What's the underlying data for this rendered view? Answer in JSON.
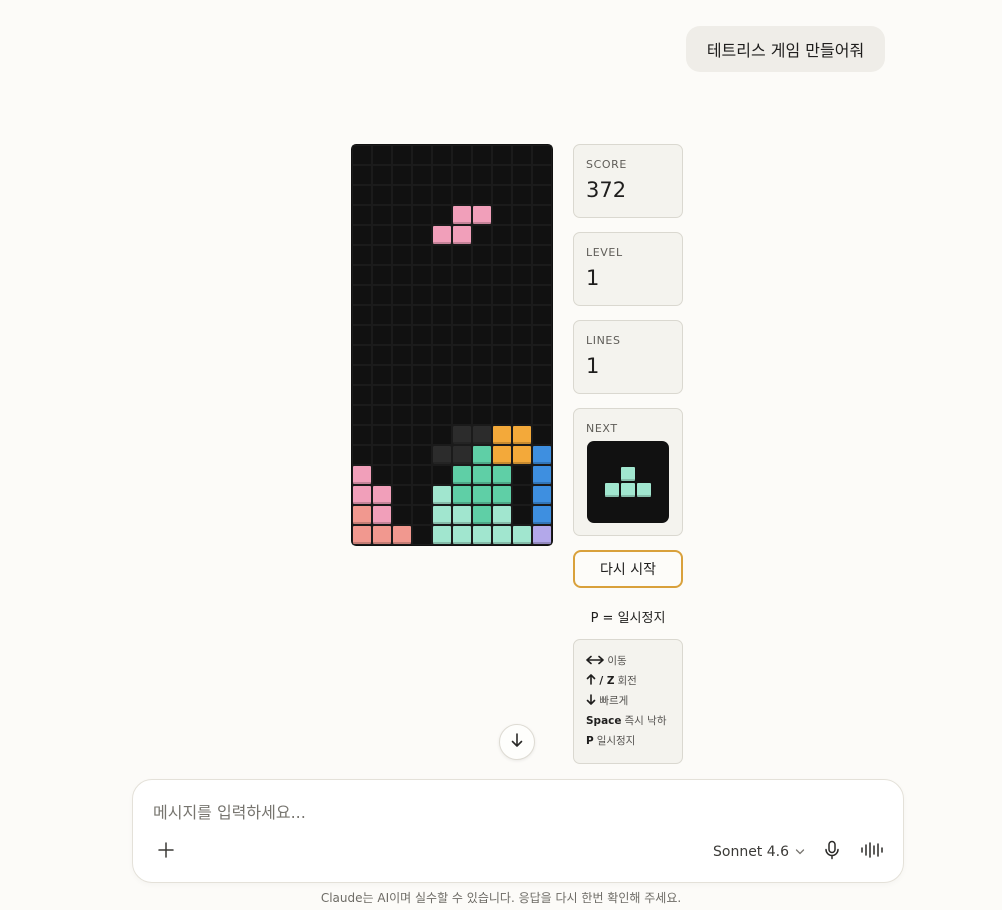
{
  "user_message": "테트리스 게임 만들어줘",
  "game": {
    "board": {
      "cols": 10,
      "rows": 20,
      "cells": [
        {
          "r": 3,
          "c": 5,
          "color": "pink"
        },
        {
          "r": 3,
          "c": 6,
          "color": "pink"
        },
        {
          "r": 4,
          "c": 4,
          "color": "pink"
        },
        {
          "r": 4,
          "c": 5,
          "color": "pink"
        },
        {
          "r": 14,
          "c": 5,
          "color": "gray"
        },
        {
          "r": 14,
          "c": 6,
          "color": "gray"
        },
        {
          "r": 14,
          "c": 7,
          "color": "orange"
        },
        {
          "r": 14,
          "c": 8,
          "color": "orange"
        },
        {
          "r": 15,
          "c": 4,
          "color": "gray"
        },
        {
          "r": 15,
          "c": 5,
          "color": "gray"
        },
        {
          "r": 15,
          "c": 6,
          "color": "green"
        },
        {
          "r": 15,
          "c": 7,
          "color": "orange"
        },
        {
          "r": 15,
          "c": 8,
          "color": "orange"
        },
        {
          "r": 15,
          "c": 9,
          "color": "blue"
        },
        {
          "r": 16,
          "c": 0,
          "color": "pink"
        },
        {
          "r": 16,
          "c": 5,
          "color": "green"
        },
        {
          "r": 16,
          "c": 6,
          "color": "green"
        },
        {
          "r": 16,
          "c": 7,
          "color": "green"
        },
        {
          "r": 16,
          "c": 9,
          "color": "blue"
        },
        {
          "r": 17,
          "c": 0,
          "color": "pink"
        },
        {
          "r": 17,
          "c": 1,
          "color": "pink"
        },
        {
          "r": 17,
          "c": 4,
          "color": "mint"
        },
        {
          "r": 17,
          "c": 5,
          "color": "green"
        },
        {
          "r": 17,
          "c": 6,
          "color": "green"
        },
        {
          "r": 17,
          "c": 7,
          "color": "green"
        },
        {
          "r": 17,
          "c": 9,
          "color": "blue"
        },
        {
          "r": 18,
          "c": 0,
          "color": "salmon"
        },
        {
          "r": 18,
          "c": 1,
          "color": "pink"
        },
        {
          "r": 18,
          "c": 4,
          "color": "mint"
        },
        {
          "r": 18,
          "c": 5,
          "color": "mint"
        },
        {
          "r": 18,
          "c": 6,
          "color": "green"
        },
        {
          "r": 18,
          "c": 7,
          "color": "mint"
        },
        {
          "r": 18,
          "c": 9,
          "color": "blue"
        },
        {
          "r": 19,
          "c": 0,
          "color": "salmon"
        },
        {
          "r": 19,
          "c": 1,
          "color": "salmon"
        },
        {
          "r": 19,
          "c": 2,
          "color": "salmon"
        },
        {
          "r": 19,
          "c": 4,
          "color": "mint"
        },
        {
          "r": 19,
          "c": 5,
          "color": "mint"
        },
        {
          "r": 19,
          "c": 6,
          "color": "mint"
        },
        {
          "r": 19,
          "c": 7,
          "color": "mint"
        },
        {
          "r": 19,
          "c": 8,
          "color": "mint"
        },
        {
          "r": 19,
          "c": 9,
          "color": "lavender"
        }
      ]
    },
    "palette": {
      "pink": "#f19fba",
      "orange": "#f3a93a",
      "green": "#5fcfa6",
      "mint": "#a1e6cf",
      "blue": "#3e8fe0",
      "salmon": "#f1988f",
      "lavender": "#b3a8ea",
      "gray": "#2c2c2c",
      "grid": "#1b1b1b",
      "board_bg": "#111111",
      "accent": "#d9a13c"
    },
    "score_label": "SCORE",
    "score": "372",
    "level_label": "LEVEL",
    "level": "1",
    "lines_label": "LINES",
    "lines": "1",
    "next_label": "NEXT",
    "next_piece": {
      "color": "mint",
      "cells": [
        {
          "r": 0,
          "c": 1
        },
        {
          "r": 1,
          "c": 0
        },
        {
          "r": 1,
          "c": 1
        },
        {
          "r": 1,
          "c": 2
        }
      ]
    },
    "restart_label": "다시 시작",
    "pause_hint": "P = 일시정지",
    "controls": [
      {
        "key": "",
        "icon": "left-right-arrow-icon",
        "desc": "이동"
      },
      {
        "key": "/ Z",
        "icon": "up-arrow-icon",
        "desc": "회전"
      },
      {
        "key": "",
        "icon": "down-arrow-icon",
        "desc": "빠르게"
      },
      {
        "key": "Space",
        "icon": "",
        "desc": "즉시 낙하"
      },
      {
        "key": "P",
        "icon": "",
        "desc": "일시정지"
      }
    ]
  },
  "composer": {
    "placeholder": "메시지를 입력하세요...",
    "model": "Sonnet 4.6",
    "icons": [
      "plus-icon",
      "chevron-down-icon",
      "microphone-icon",
      "voice-waveform-icon",
      "arrow-down-icon"
    ]
  },
  "disclaimer": "Claude는 AI이며 실수할 수 있습니다. 응답을 다시 한번 확인해 주세요."
}
